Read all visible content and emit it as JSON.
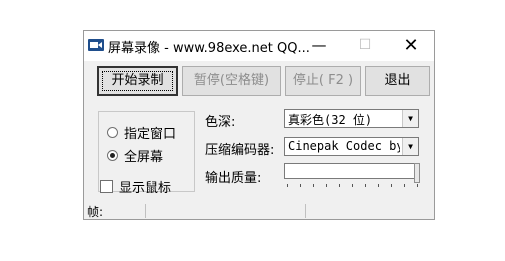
{
  "window": {
    "title": "屏幕录像 - www.98exe.net QQ...",
    "minimize_glyph": "—",
    "maximize_glyph": "☐",
    "close_glyph": "✕"
  },
  "buttons": {
    "start": "开始录制",
    "pause": "暂停(空格键)",
    "stop": "停止( F2 )",
    "exit": "退出"
  },
  "capture_mode": {
    "options": [
      "指定窗口",
      "全屏幕"
    ],
    "selected": "全屏幕"
  },
  "show_cursor": {
    "label": "显示鼠标",
    "checked": false
  },
  "settings": {
    "color_depth_label": "色深:",
    "color_depth_value": "真彩色(32 位)",
    "codec_label": "压缩编码器:",
    "codec_value": "Cinepak Codec by",
    "quality_label": "输出质量:",
    "quality_level": 1.0
  },
  "statusbar": {
    "frames_label": "帧:"
  },
  "colors": {
    "titlebar": "#ffffff",
    "face": "#f0f0f0",
    "icon": "#1f4e8c"
  },
  "icons": {
    "app": "video-camera-icon"
  }
}
